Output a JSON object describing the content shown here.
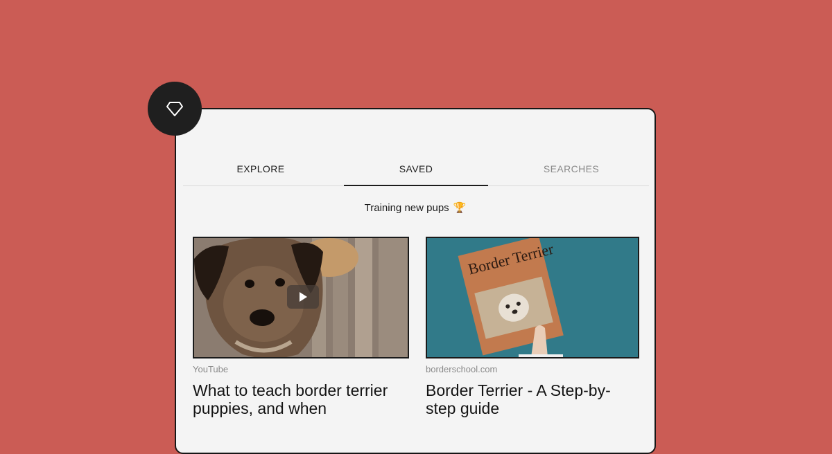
{
  "colors": {
    "background": "#cb5c55",
    "panel": "#f4f4f4",
    "badge": "#1f1f1f"
  },
  "badge": {
    "icon": "diamond-icon"
  },
  "tabs": [
    {
      "label": "EXPLORE",
      "state": "normal"
    },
    {
      "label": "SAVED",
      "state": "active"
    },
    {
      "label": "SEARCHES",
      "state": "muted"
    }
  ],
  "collection": {
    "name": "Training new pups",
    "icon": "🏆"
  },
  "cards": [
    {
      "source": "YouTube",
      "title": "What to teach border terrier puppies, and when",
      "image": "border terrier close-up video thumbnail",
      "icon": "play-icon"
    },
    {
      "source": "borderschool.com",
      "title": "Border Terrier - A Step-by-step guide",
      "image": "hand holding Border Terrier book",
      "book_title": "Border Terrier"
    }
  ]
}
